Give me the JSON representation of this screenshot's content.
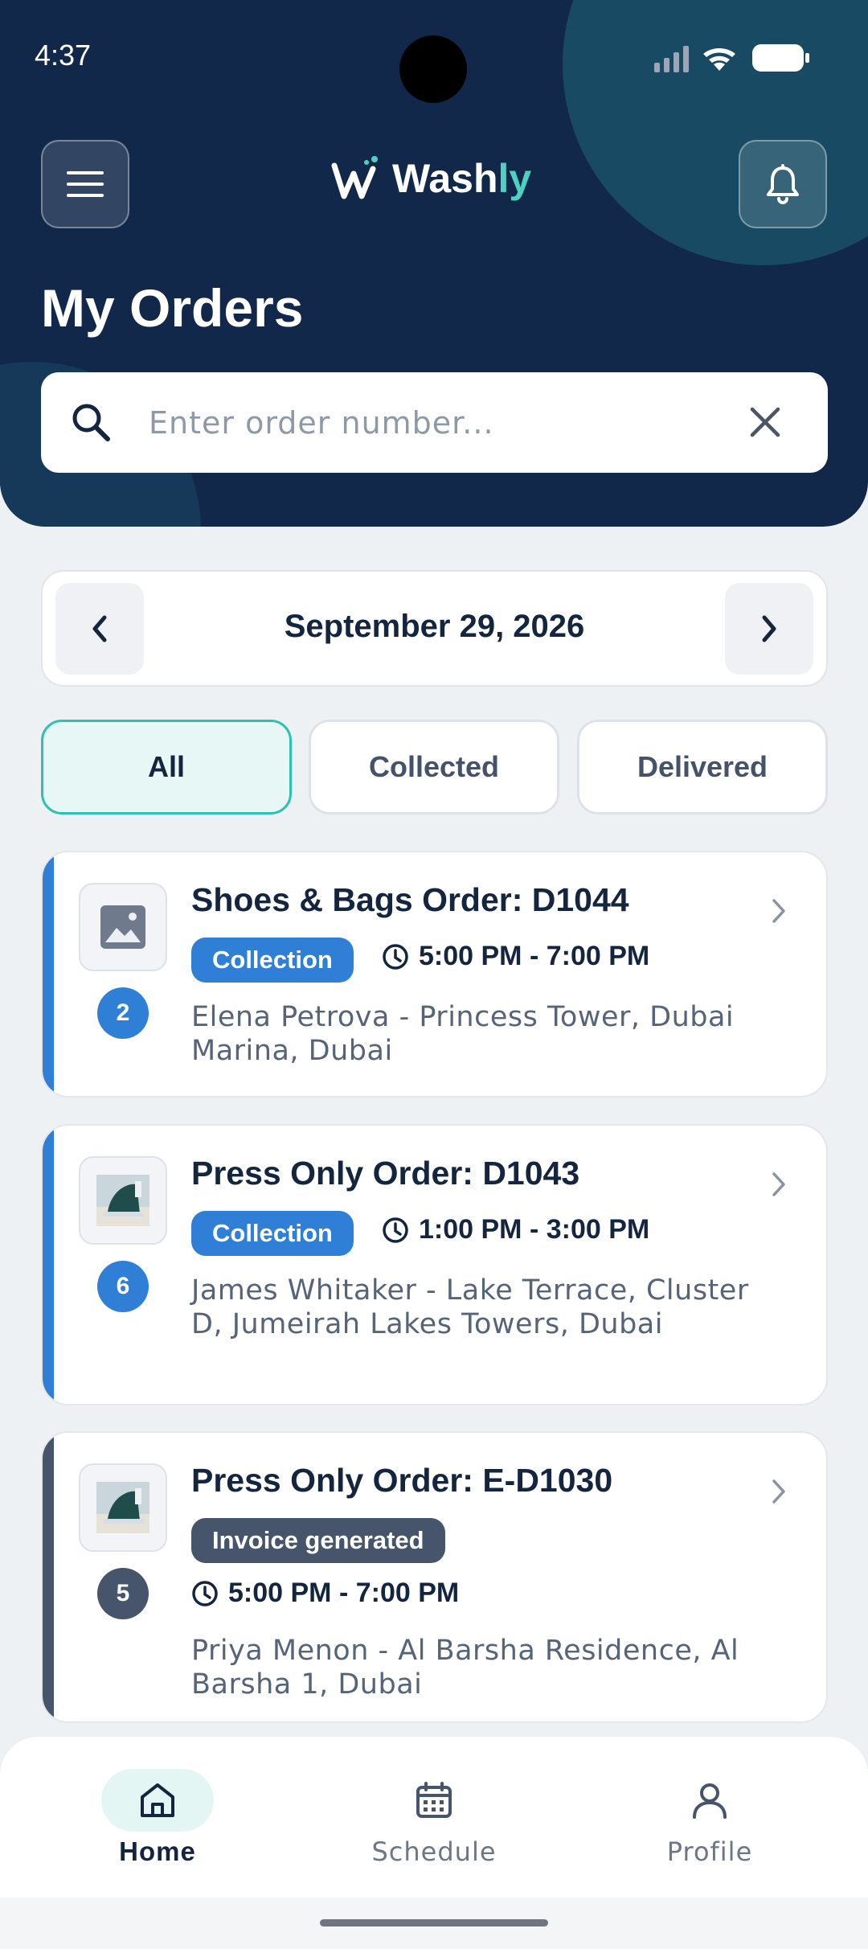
{
  "status_bar": {
    "time": "4:37"
  },
  "app": {
    "logo_main": "Wash",
    "logo_accent": "ly",
    "brand_color": "#11284a",
    "accent_color": "#4fd1c2"
  },
  "header": {
    "title": "My Orders"
  },
  "search": {
    "placeholder": "Enter order number...",
    "value": ""
  },
  "date_bar": {
    "date": "September 29, 2026"
  },
  "filters": [
    {
      "label": "All",
      "active": true
    },
    {
      "label": "Collected",
      "active": false
    },
    {
      "label": "Delivered",
      "active": false
    }
  ],
  "orders": [
    {
      "title": "Shoes & Bags Order: D1044",
      "badge": "Collection",
      "badge_color": "#2f7fd6",
      "time": "5:00 PM - 7:00 PM",
      "address": "Elena Petrova - Princess Tower, Dubai Marina, Dubai",
      "count": "2",
      "thumbnail": "image-placeholder-icon"
    },
    {
      "title": "Press Only Order: D1043",
      "badge": "Collection",
      "badge_color": "#2f7fd6",
      "time": "1:00 PM - 3:00 PM",
      "address": "James Whitaker - Lake Terrace, Cluster D, Jumeirah Lakes Towers, Dubai",
      "count": "6",
      "thumbnail": "iron-photo"
    },
    {
      "title": "Press Only Order: E-D1030",
      "badge": "Invoice generated",
      "badge_color": "#46556b",
      "time": "5:00 PM - 7:00 PM",
      "address": "Priya Menon - Al Barsha Residence, Al Barsha 1, Dubai",
      "count": "5",
      "thumbnail": "iron-photo"
    }
  ],
  "bottom_nav": [
    {
      "label": "Home",
      "icon": "home-icon",
      "active": true
    },
    {
      "label": "Schedule",
      "icon": "calendar-icon",
      "active": false
    },
    {
      "label": "Profile",
      "icon": "user-icon",
      "active": false
    }
  ]
}
